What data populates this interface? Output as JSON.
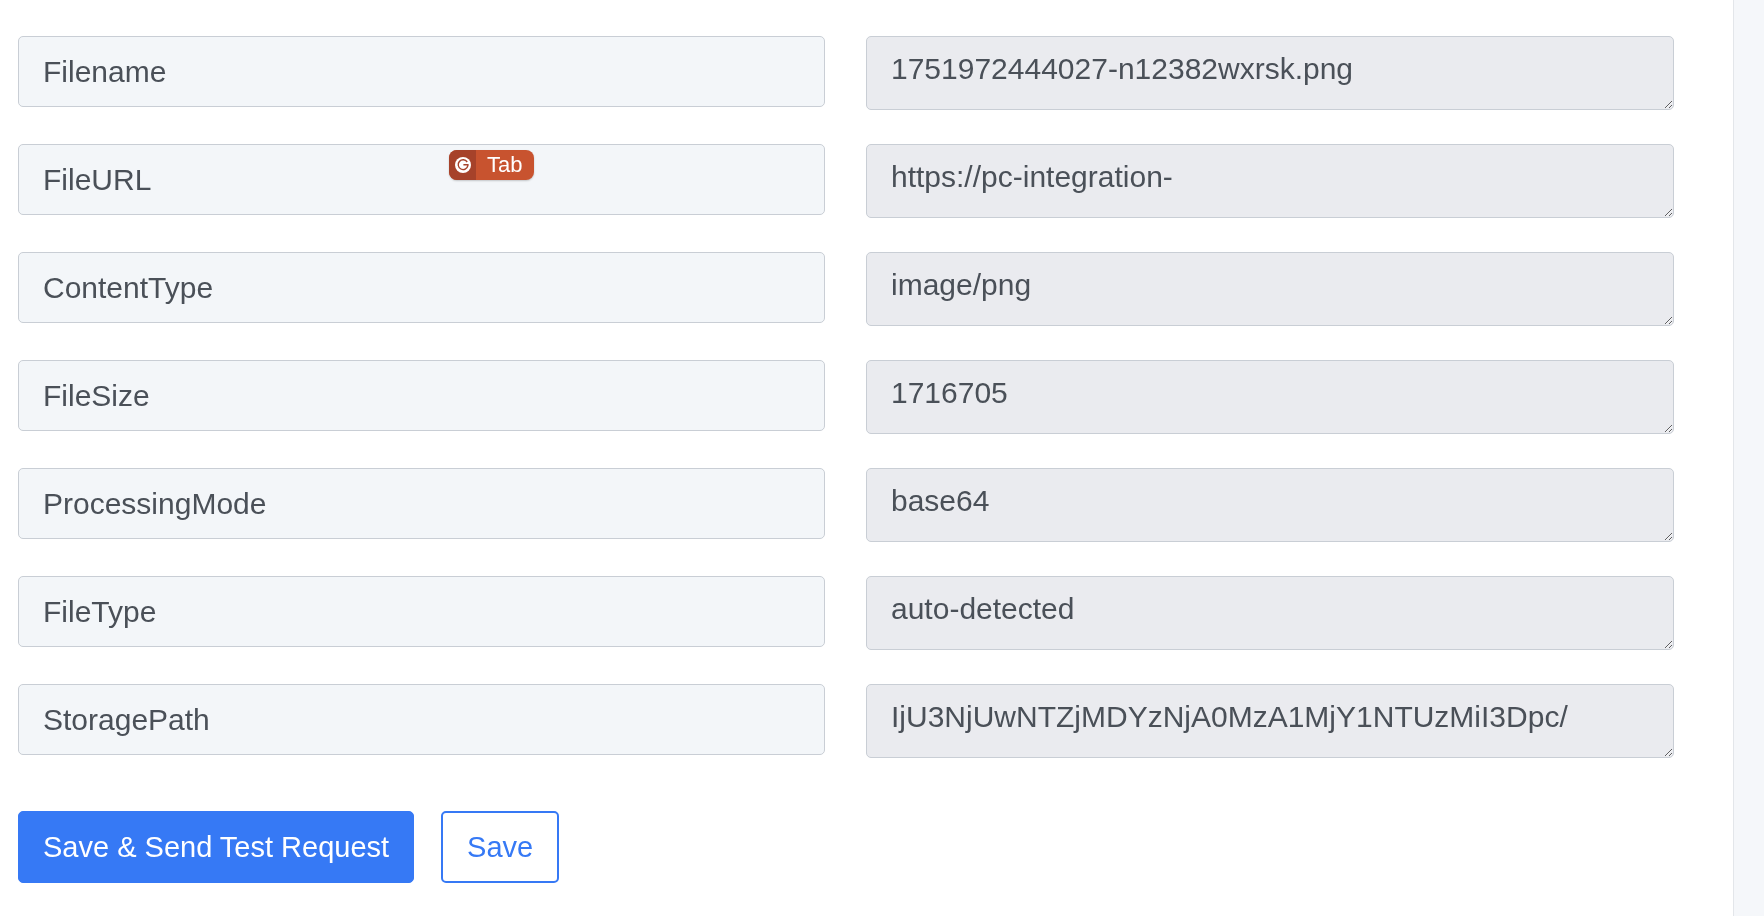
{
  "fields": [
    {
      "key": "Filename",
      "value": "1751972444027-n12382wxrsk.png",
      "readonly": true
    },
    {
      "key": "FileURL",
      "value": "https://pc-integration-",
      "readonly": true,
      "hint_chip": {
        "label": "Tab"
      }
    },
    {
      "key": "ContentType",
      "value": "image/png",
      "readonly": true
    },
    {
      "key": "FileSize",
      "value": "1716705",
      "readonly": true
    },
    {
      "key": "ProcessingMode",
      "value": "base64",
      "readonly": true
    },
    {
      "key": "FileType",
      "value": "auto-detected",
      "readonly": true
    },
    {
      "key": "StoragePath",
      "value": "IjU3NjUwNTZjMDYzNjA0MzA1MjY1NTUzMiI3Dpc/",
      "readonly": true
    }
  ],
  "buttons": [
    {
      "label": "Save & Send Test Request",
      "kind": "primary"
    },
    {
      "label": "Save",
      "kind": "outline"
    }
  ]
}
